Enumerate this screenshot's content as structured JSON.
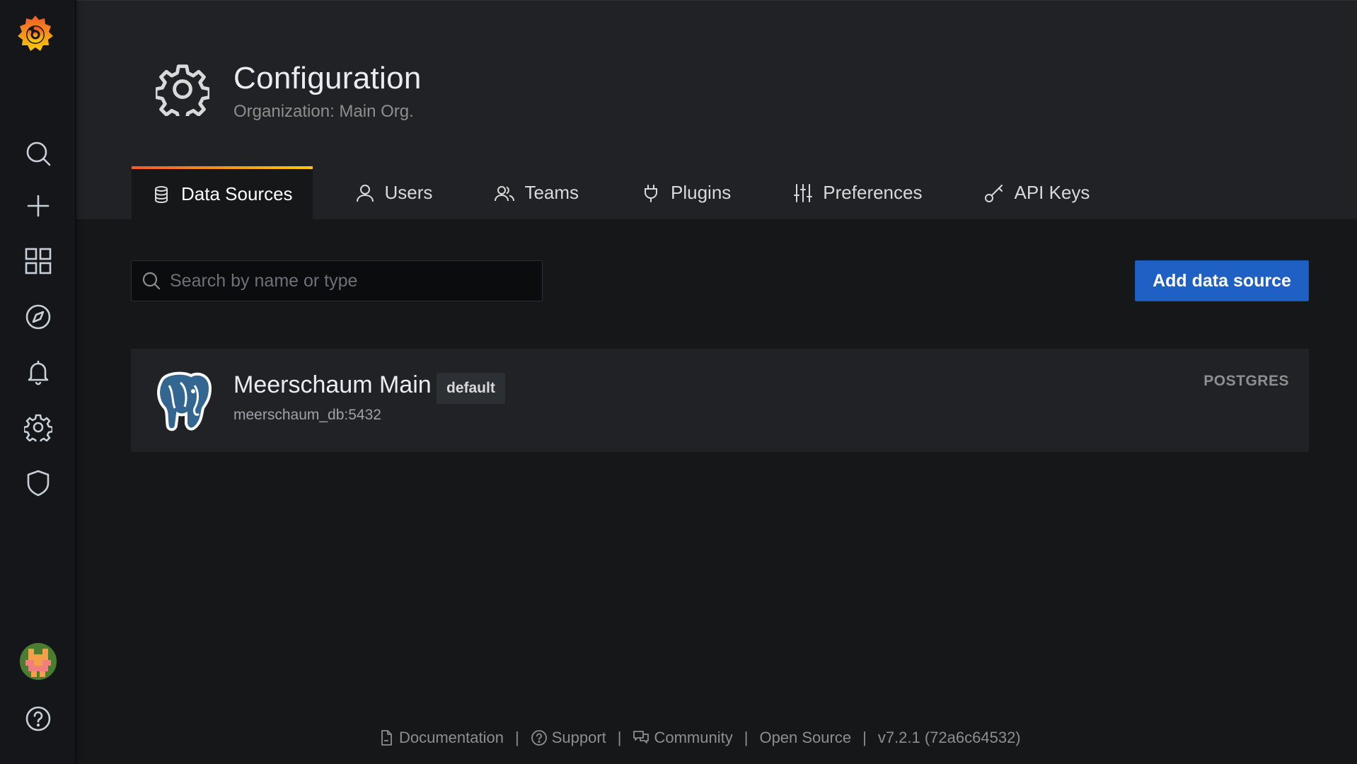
{
  "header": {
    "title": "Configuration",
    "subtitle": "Organization: Main Org."
  },
  "tabs": [
    {
      "label": "Data Sources",
      "icon": "database-icon",
      "active": true
    },
    {
      "label": "Users",
      "icon": "user-icon",
      "active": false
    },
    {
      "label": "Teams",
      "icon": "users-icon",
      "active": false
    },
    {
      "label": "Plugins",
      "icon": "plug-icon",
      "active": false
    },
    {
      "label": "Preferences",
      "icon": "sliders-icon",
      "active": false
    },
    {
      "label": "API Keys",
      "icon": "key-icon",
      "active": false
    }
  ],
  "search": {
    "placeholder": "Search by name or type",
    "value": ""
  },
  "add_button": {
    "label": "Add data source"
  },
  "datasources": [
    {
      "name": "Meerschaum Main",
      "badge": "default",
      "url": "meerschaum_db:5432",
      "type": "POSTGRES"
    }
  ],
  "sidebar": {
    "items": [
      "search-icon",
      "plus-icon",
      "dashboards-icon",
      "explore-icon",
      "alert-bell-icon",
      "gear-icon",
      "shield-icon"
    ],
    "help_icon": "help-icon"
  },
  "footer": {
    "documentation": "Documentation",
    "support": "Support",
    "community": "Community",
    "open_source": "Open Source",
    "version": "v7.2.1 (72a6c64532)",
    "separator": "|"
  },
  "colors": {
    "accent_blue": "#1f60c4",
    "tab_gradient_start": "#f05a28",
    "tab_gradient_end": "#fbca0a",
    "background": "#161719",
    "panel": "#202226"
  }
}
